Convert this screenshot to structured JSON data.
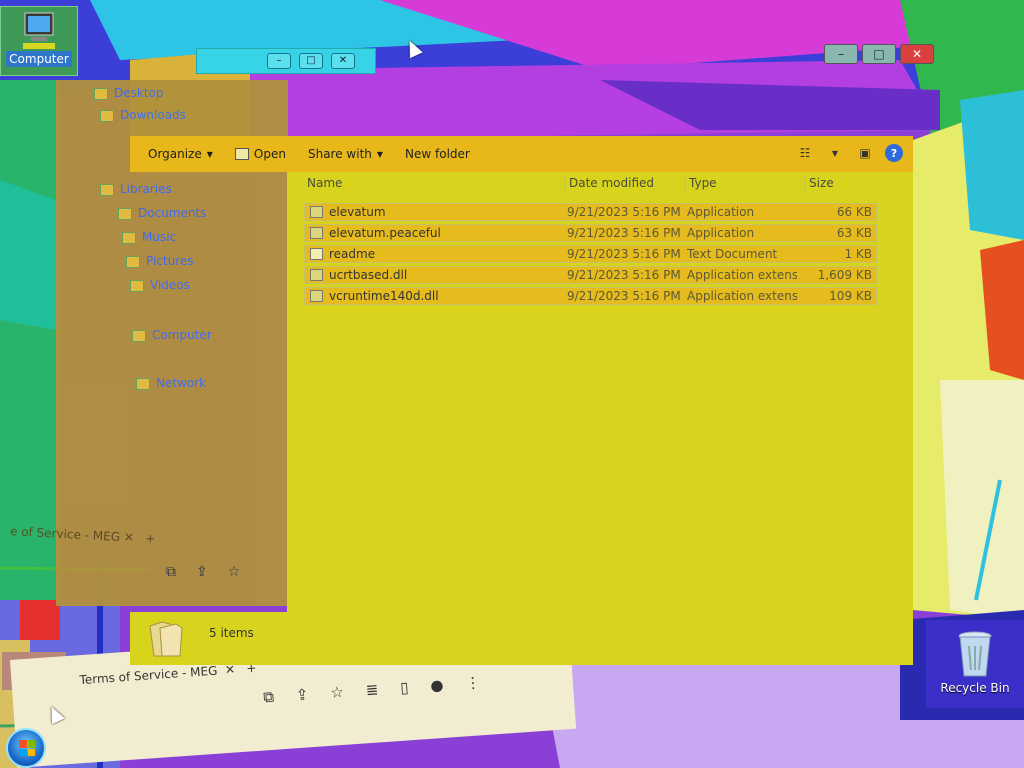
{
  "desktop": {
    "computer_label": "Computer",
    "recycle_label": "Recycle Bin"
  },
  "ghost_nav": {
    "items": [
      "Desktop",
      "Downloads",
      "Libraries",
      "Documents",
      "Music",
      "Pictures",
      "Videos",
      "Computer",
      "Network"
    ]
  },
  "ghost_browser": {
    "tab_title": "Terms of Service - MEG",
    "tab_title_upper": "e of Service - MEG"
  },
  "toolbar": {
    "organize": "Organize",
    "open": "Open",
    "share_with": "Share with",
    "new_folder": "New folder",
    "help": "?"
  },
  "columns": {
    "name": "Name",
    "date_modified": "Date modified",
    "type": "Type",
    "size": "Size"
  },
  "files": [
    {
      "name": "elevatum",
      "date": "9/21/2023 5:16 PM",
      "type": "Application",
      "size": "66 KB",
      "icon": "application-icon"
    },
    {
      "name": "elevatum.peaceful",
      "date": "9/21/2023 5:16 PM",
      "type": "Application",
      "size": "63 KB",
      "icon": "application-icon"
    },
    {
      "name": "readme",
      "date": "9/21/2023 5:16 PM",
      "type": "Text Document",
      "size": "1 KB",
      "icon": "text-document-icon"
    },
    {
      "name": "ucrtbased.dll",
      "date": "9/21/2023 5:16 PM",
      "type": "Application extens...",
      "size": "1,609 KB",
      "icon": "dll-icon"
    },
    {
      "name": "vcruntime140d.dll",
      "date": "9/21/2023 5:16 PM",
      "type": "Application extens...",
      "size": "109 KB",
      "icon": "dll-icon"
    }
  ],
  "status": {
    "count": "5 items"
  },
  "colors": {
    "toolbar": "#e8b81a",
    "content": "#d8d41e",
    "row": "#e6bb1d"
  }
}
